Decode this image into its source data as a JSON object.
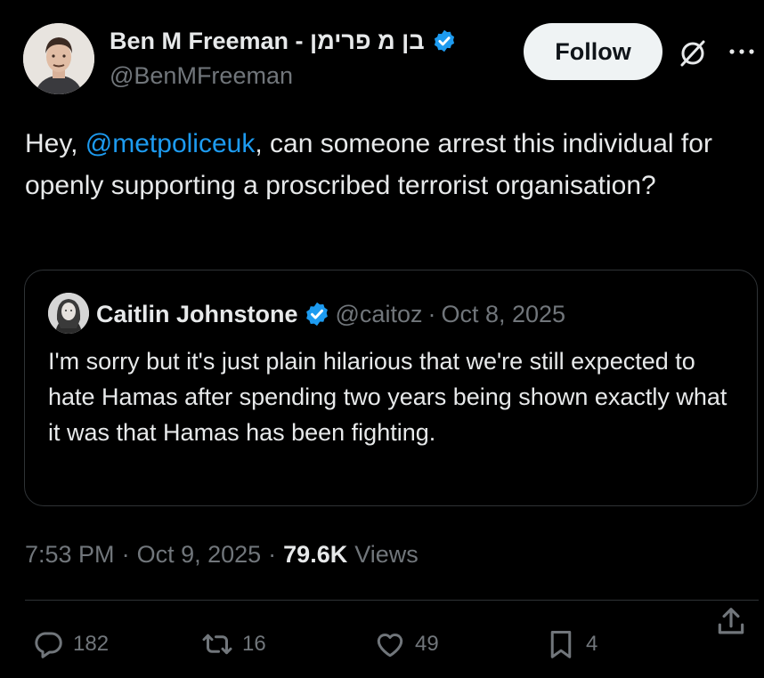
{
  "author": {
    "display_name": "Ben M Freeman - בן מ פרימן",
    "handle": "@BenMFreeman",
    "verified": true
  },
  "follow_label": "Follow",
  "tweet": {
    "greeting": "Hey, ",
    "mention": "@metpoliceuk",
    "body": ", can someone arrest this individual for openly supporting a proscribed terrorist organisation?"
  },
  "quoted": {
    "display_name": "Caitlin Johnstone",
    "handle": "@caitoz",
    "separator": "·",
    "date": "Oct 8, 2025",
    "text": "I'm sorry but it's just plain hilarious that we're still expected to hate Hamas after spending two years being shown exactly what it was that Hamas has been fighting."
  },
  "meta": {
    "time": "7:53 PM",
    "sep1": "·",
    "date": "Oct 9, 2025",
    "sep2": "·",
    "views_count": "79.6K",
    "views_label": "Views"
  },
  "actions": {
    "replies": "182",
    "reposts": "16",
    "likes": "49",
    "bookmarks": "4"
  },
  "colors": {
    "background": "#000000",
    "text": "#e7e9ea",
    "secondary": "#71767b",
    "accent": "#1d9bf0",
    "border": "#2f3336"
  }
}
